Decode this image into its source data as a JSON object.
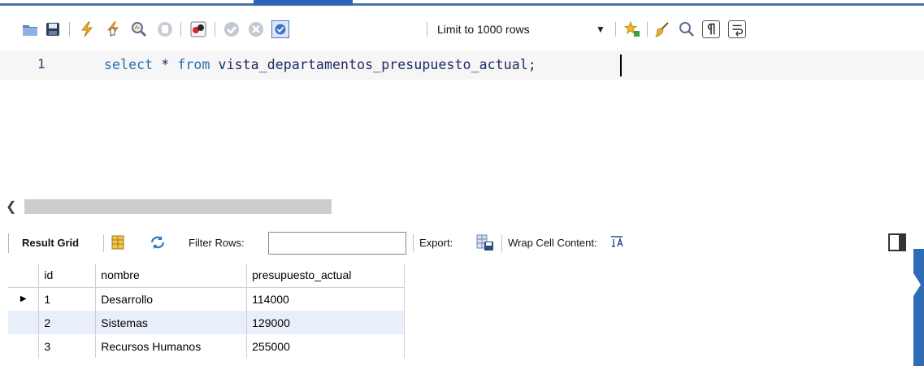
{
  "toolbar": {
    "icons": [
      "open-folder-icon",
      "save-icon",
      "execute-icon",
      "execute-current-icon",
      "explain-icon",
      "stop-icon",
      "toggle-stop-on-error-icon",
      "commit-icon",
      "rollback-icon",
      "autocommit-icon",
      "beautify-icon",
      "find-icon",
      "invisible-chars-icon",
      "word-wrap-icon"
    ],
    "limit_rows": "Limit to 1000 rows"
  },
  "editor": {
    "line_number": "1",
    "keywords": [
      "select",
      "from"
    ],
    "star": "*",
    "object_name": "vista_departamentos_presupuesto_actual",
    "terminator": ";"
  },
  "result_toolbar": {
    "result_grid_label": "Result Grid",
    "filter_rows_label": "Filter Rows:",
    "filter_value": "",
    "export_label": "Export:",
    "wrap_label": "Wrap Cell Content:"
  },
  "grid": {
    "columns": [
      "id",
      "nombre",
      "presupuesto_actual"
    ],
    "rows": [
      [
        "1",
        "Desarrollo",
        "114000"
      ],
      [
        "2",
        "Sistemas",
        "129000"
      ],
      [
        "3",
        "Recursos Humanos",
        "255000"
      ]
    ]
  },
  "colors": {
    "accent": "#2f63b8",
    "keyword": "#1f6fb5",
    "identifier": "#1d2a62",
    "row_highlight": "#e8effa"
  }
}
